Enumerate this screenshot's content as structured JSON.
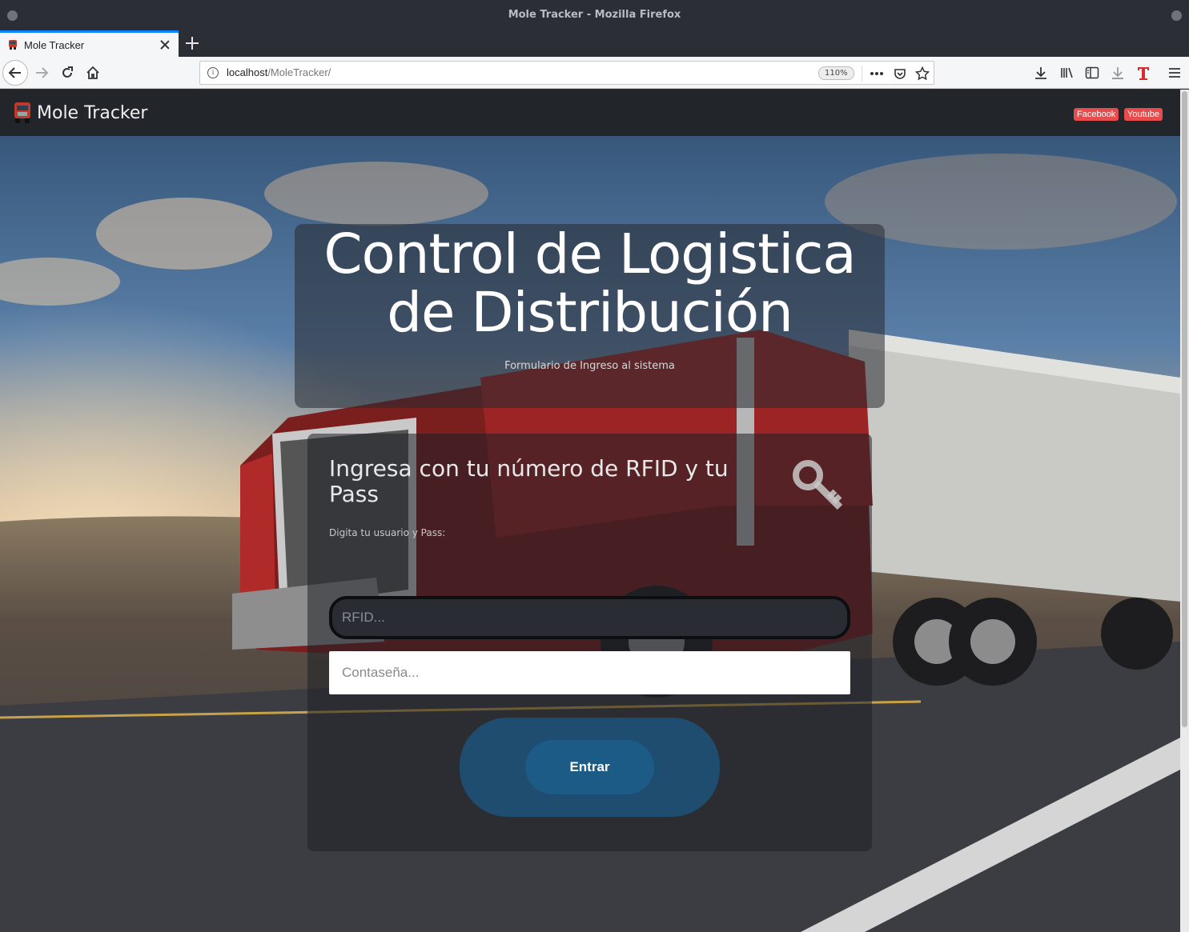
{
  "window": {
    "title": "Mole Tracker - Mozilla Firefox"
  },
  "tab": {
    "title": "Mole Tracker"
  },
  "address_bar": {
    "host": "localhost",
    "path": "/MoleTracker/",
    "zoom": "110%"
  },
  "site": {
    "brand": "Mole Tracker",
    "social": {
      "facebook": "Facebook",
      "youtube": "Youtube"
    }
  },
  "hero": {
    "title": "Control de Logistica de Distribución",
    "subtitle": "Formulario de Ingreso al sistema"
  },
  "login": {
    "title": "Ingresa con tu número de RFID y tu Pass",
    "subtitle": "Digita tu usuario y Pass:",
    "rfid_placeholder": "RFID...",
    "password_placeholder": "Contaseña...",
    "submit_label": "Entrar"
  },
  "colors": {
    "brand_badge": "#e84b4b",
    "button": "#1c5b85",
    "tab_accent": "#0a84ff"
  }
}
